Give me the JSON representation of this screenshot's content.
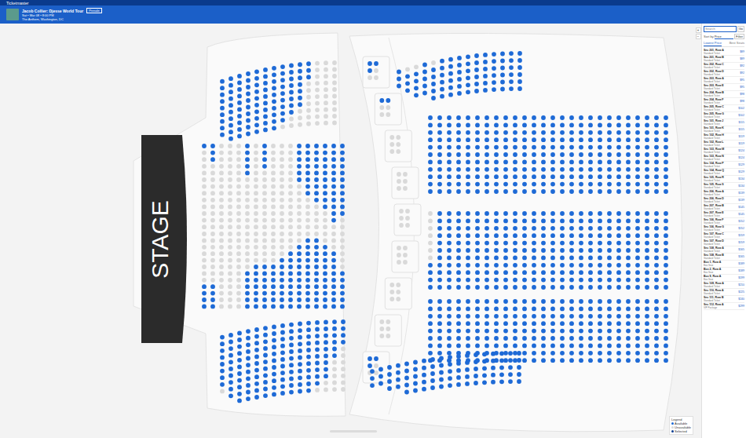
{
  "window": {
    "title": "Ticketmaster"
  },
  "header": {
    "title": "Jacob Collier: Djesse World Tour",
    "badge": "Presale",
    "date": "Sat • Mar 08 • 8:00 PM",
    "venue": "The Anthem, Washington, DC"
  },
  "stage": "STAGE",
  "zoom": [
    "+",
    "−"
  ],
  "panel": {
    "search_placeholder": "Search",
    "search_button": "Go",
    "sort_label": "Sort by",
    "sort_value": "Price",
    "filter_button": "Filter",
    "tabs": [
      {
        "label": "Lowest Price",
        "selected": true
      },
      {
        "label": "Best Seats",
        "selected": false
      }
    ],
    "listings": [
      {
        "section": "Sec 201, Row A",
        "detail": "Standard Ticket",
        "price": "$89"
      },
      {
        "section": "Sec 201, Row B",
        "detail": "Standard Ticket",
        "price": "$89"
      },
      {
        "section": "Sec 202, Row C",
        "detail": "Standard Ticket",
        "price": "$92"
      },
      {
        "section": "Sec 202, Row D",
        "detail": "Standard Ticket",
        "price": "$92"
      },
      {
        "section": "Sec 203, Row A",
        "detail": "Standard Ticket",
        "price": "$95"
      },
      {
        "section": "Sec 203, Row E",
        "detail": "Standard Ticket",
        "price": "$95"
      },
      {
        "section": "Sec 204, Row B",
        "detail": "Standard Ticket",
        "price": "$98"
      },
      {
        "section": "Sec 204, Row F",
        "detail": "Standard Ticket",
        "price": "$98"
      },
      {
        "section": "Sec 205, Row C",
        "detail": "Standard Ticket",
        "price": "$102"
      },
      {
        "section": "Sec 205, Row G",
        "detail": "Standard Ticket",
        "price": "$102"
      },
      {
        "section": "Sec 101, Row J",
        "detail": "Standard Ticket",
        "price": "$115"
      },
      {
        "section": "Sec 101, Row K",
        "detail": "Standard Ticket",
        "price": "$115"
      },
      {
        "section": "Sec 102, Row H",
        "detail": "Standard Ticket",
        "price": "$119"
      },
      {
        "section": "Sec 102, Row L",
        "detail": "Standard Ticket",
        "price": "$119"
      },
      {
        "section": "Sec 103, Row M",
        "detail": "Standard Ticket",
        "price": "$124"
      },
      {
        "section": "Sec 103, Row N",
        "detail": "Standard Ticket",
        "price": "$124"
      },
      {
        "section": "Sec 104, Row P",
        "detail": "Standard Ticket",
        "price": "$129"
      },
      {
        "section": "Sec 104, Row Q",
        "detail": "Standard Ticket",
        "price": "$129"
      },
      {
        "section": "Sec 105, Row R",
        "detail": "Standard Ticket",
        "price": "$134"
      },
      {
        "section": "Sec 105, Row S",
        "detail": "Standard Ticket",
        "price": "$134"
      },
      {
        "section": "Sec 206, Row A",
        "detail": "Standard Ticket",
        "price": "$139"
      },
      {
        "section": "Sec 206, Row D",
        "detail": "Standard Ticket",
        "price": "$139"
      },
      {
        "section": "Sec 207, Row B",
        "detail": "Standard Ticket",
        "price": "$145"
      },
      {
        "section": "Sec 207, Row E",
        "detail": "Standard Ticket",
        "price": "$145"
      },
      {
        "section": "Sec 106, Row F",
        "detail": "Standard Ticket",
        "price": "$152"
      },
      {
        "section": "Sec 106, Row G",
        "detail": "Standard Ticket",
        "price": "$152"
      },
      {
        "section": "Sec 107, Row C",
        "detail": "Standard Ticket",
        "price": "$159"
      },
      {
        "section": "Sec 107, Row D",
        "detail": "Standard Ticket",
        "price": "$159"
      },
      {
        "section": "Sec 108, Row A",
        "detail": "Standard Ticket",
        "price": "$165"
      },
      {
        "section": "Sec 108, Row B",
        "detail": "Standard Ticket",
        "price": "$165"
      },
      {
        "section": "Box 1, Row A",
        "detail": "Box Seat",
        "price": "$189"
      },
      {
        "section": "Box 2, Row A",
        "detail": "Box Seat",
        "price": "$189"
      },
      {
        "section": "Box 9, Row A",
        "detail": "Box Seat",
        "price": "$199"
      },
      {
        "section": "Sec 109, Row A",
        "detail": "Standard Ticket",
        "price": "$210"
      },
      {
        "section": "Sec 110, Row A",
        "detail": "Standard Ticket",
        "price": "$225"
      },
      {
        "section": "Sec 111, Row B",
        "detail": "Standard Ticket",
        "price": "$240"
      },
      {
        "section": "Sec 112, Row A",
        "detail": "VIP Package",
        "price": "$299"
      }
    ]
  },
  "legend": {
    "title": "Legend",
    "items": [
      {
        "label": "Available",
        "color": "#1e6ad6"
      },
      {
        "label": "Unavailable",
        "color": "#d9d9d9"
      },
      {
        "label": "Selected",
        "color": "#0b3d91"
      }
    ]
  },
  "sections": [
    {
      "open_from": "top",
      "columns": [
        {
          "seats": 9,
          "open": 9
        },
        {
          "seats": 10,
          "open": 10
        },
        {
          "seats": 10,
          "open": 10
        },
        {
          "seats": 10,
          "open": 10
        },
        {
          "seats": 10,
          "open": 10
        },
        {
          "seats": 10,
          "open": 10
        },
        {
          "seats": 10,
          "open": 10
        },
        {
          "seats": 10,
          "open": 9
        },
        {
          "seats": 10,
          "open": 8
        },
        {
          "seats": 10,
          "open": 7
        },
        {
          "seats": 10,
          "open": 3
        },
        {
          "seats": 10,
          "open": 0
        },
        {
          "seats": 10,
          "open": 0
        },
        {
          "seats": 10,
          "open": 0
        }
      ]
    },
    {
      "open_from": "top",
      "columns": [
        {
          "seats": 13,
          "open": 1
        },
        {
          "seats": 13,
          "open": 3
        },
        {
          "seats": 13,
          "open": 0
        },
        {
          "seats": 13,
          "open": 0
        },
        {
          "seats": 13,
          "open": 0
        },
        {
          "seats": 13,
          "open": 5
        },
        {
          "seats": 13,
          "open": 0
        },
        {
          "seats": 13,
          "open": 4
        },
        {
          "seats": 13,
          "open": 0
        },
        {
          "seats": 13,
          "open": 0
        },
        {
          "seats": 13,
          "open": 0
        },
        {
          "seats": 13,
          "open": 6
        },
        {
          "seats": 13,
          "open": 8
        },
        {
          "seats": 13,
          "open": 9
        },
        {
          "seats": 13,
          "open": 10
        },
        {
          "seats": 13,
          "open": 12
        },
        {
          "seats": 13,
          "open": 11
        }
      ]
    },
    {
      "open_from": "bottom",
      "columns": [
        {
          "seats": 12,
          "open": 4
        },
        {
          "seats": 12,
          "open": 4
        },
        {
          "seats": 12,
          "open": 0
        },
        {
          "seats": 12,
          "open": 0
        },
        {
          "seats": 12,
          "open": 0
        },
        {
          "seats": 12,
          "open": 6
        },
        {
          "seats": 12,
          "open": 7
        },
        {
          "seats": 12,
          "open": 7
        },
        {
          "seats": 12,
          "open": 7
        },
        {
          "seats": 12,
          "open": 8
        },
        {
          "seats": 12,
          "open": 9
        },
        {
          "seats": 12,
          "open": 10
        },
        {
          "seats": 12,
          "open": 11
        },
        {
          "seats": 12,
          "open": 11
        },
        {
          "seats": 12,
          "open": 10
        },
        {
          "seats": 12,
          "open": 9
        },
        {
          "seats": 12,
          "open": 6
        }
      ]
    },
    {
      "open_from": "top",
      "columns": [
        {
          "seats": 9,
          "open": 8
        },
        {
          "seats": 10,
          "open": 10
        },
        {
          "seats": 11,
          "open": 11
        },
        {
          "seats": 11,
          "open": 11
        },
        {
          "seats": 11,
          "open": 11
        },
        {
          "seats": 11,
          "open": 11
        },
        {
          "seats": 11,
          "open": 11
        },
        {
          "seats": 11,
          "open": 11
        },
        {
          "seats": 11,
          "open": 11
        },
        {
          "seats": 11,
          "open": 11
        },
        {
          "seats": 11,
          "open": 11
        },
        {
          "seats": 11,
          "open": 10
        },
        {
          "seats": 11,
          "open": 9
        },
        {
          "seats": 11,
          "open": 6
        },
        {
          "seats": 11,
          "open": 4
        }
      ]
    },
    {
      "open_from": "bottom",
      "columns": [
        {
          "seats": 3,
          "open": 3
        },
        {
          "seats": 4,
          "open": 3
        },
        {
          "seats": 5,
          "open": 4
        },
        {
          "seats": 5,
          "open": 5
        },
        {
          "seats": 6,
          "open": 5
        },
        {
          "seats": 6,
          "open": 6
        },
        {
          "seats": 6,
          "open": 6
        },
        {
          "seats": 6,
          "open": 6
        },
        {
          "seats": 6,
          "open": 6
        },
        {
          "seats": 6,
          "open": 6
        },
        {
          "seats": 6,
          "open": 6
        },
        {
          "seats": 6,
          "open": 6
        },
        {
          "seats": 6,
          "open": 6
        },
        {
          "seats": 6,
          "open": 6
        },
        {
          "seats": 6,
          "open": 6
        }
      ]
    },
    {
      "open_from": "top",
      "columns": [
        {
          "seats": 11,
          "open": 11
        },
        {
          "seats": 11,
          "open": 11
        },
        {
          "seats": 11,
          "open": 11
        },
        {
          "seats": 11,
          "open": 11
        },
        {
          "seats": 11,
          "open": 11
        },
        {
          "seats": 11,
          "open": 11
        },
        {
          "seats": 11,
          "open": 11
        },
        {
          "seats": 11,
          "open": 11
        },
        {
          "seats": 11,
          "open": 11
        },
        {
          "seats": 11,
          "open": 11
        },
        {
          "seats": 11,
          "open": 11
        },
        {
          "seats": 11,
          "open": 11
        },
        {
          "seats": 11,
          "open": 11
        },
        {
          "seats": 11,
          "open": 11
        },
        {
          "seats": 11,
          "open": 11
        },
        {
          "seats": 11,
          "open": 11
        },
        {
          "seats": 11,
          "open": 11
        },
        {
          "seats": 11,
          "open": 11
        },
        {
          "seats": 11,
          "open": 11
        },
        {
          "seats": 11,
          "open": 11
        },
        {
          "seats": 11,
          "open": 11
        },
        {
          "seats": 11,
          "open": 11
        },
        {
          "seats": 11,
          "open": 11
        },
        {
          "seats": 11,
          "open": 11
        },
        {
          "seats": 11,
          "open": 11
        },
        {
          "seats": 11,
          "open": 11
        }
      ]
    },
    {
      "open_from": "bottom",
      "columns": [
        {
          "seats": 11,
          "open": 4
        },
        {
          "seats": 11,
          "open": 11
        },
        {
          "seats": 11,
          "open": 11
        },
        {
          "seats": 11,
          "open": 11
        },
        {
          "seats": 11,
          "open": 11
        },
        {
          "seats": 11,
          "open": 11
        },
        {
          "seats": 11,
          "open": 11
        },
        {
          "seats": 11,
          "open": 11
        },
        {
          "seats": 11,
          "open": 11
        },
        {
          "seats": 11,
          "open": 11
        },
        {
          "seats": 11,
          "open": 11
        },
        {
          "seats": 11,
          "open": 11
        },
        {
          "seats": 11,
          "open": 11
        },
        {
          "seats": 11,
          "open": 11
        },
        {
          "seats": 11,
          "open": 11
        },
        {
          "seats": 11,
          "open": 11
        },
        {
          "seats": 11,
          "open": 11
        },
        {
          "seats": 11,
          "open": 11
        },
        {
          "seats": 11,
          "open": 11
        },
        {
          "seats": 11,
          "open": 11
        },
        {
          "seats": 11,
          "open": 11
        },
        {
          "seats": 11,
          "open": 11
        },
        {
          "seats": 11,
          "open": 11
        },
        {
          "seats": 11,
          "open": 11
        },
        {
          "seats": 11,
          "open": 11
        },
        {
          "seats": 11,
          "open": 11
        }
      ]
    },
    {
      "open_from": "top",
      "columns": [
        {
          "seats": 9,
          "open": 9
        },
        {
          "seats": 9,
          "open": 9
        },
        {
          "seats": 9,
          "open": 9
        },
        {
          "seats": 9,
          "open": 9
        },
        {
          "seats": 9,
          "open": 9
        },
        {
          "seats": 9,
          "open": 9
        },
        {
          "seats": 9,
          "open": 9
        },
        {
          "seats": 9,
          "open": 9
        },
        {
          "seats": 9,
          "open": 9
        },
        {
          "seats": 9,
          "open": 9
        },
        {
          "seats": 9,
          "open": 9
        },
        {
          "seats": 9,
          "open": 9
        },
        {
          "seats": 9,
          "open": 9
        },
        {
          "seats": 9,
          "open": 9
        },
        {
          "seats": 9,
          "open": 9
        },
        {
          "seats": 9,
          "open": 9
        },
        {
          "seats": 9,
          "open": 9
        },
        {
          "seats": 9,
          "open": 9
        },
        {
          "seats": 9,
          "open": 9
        },
        {
          "seats": 9,
          "open": 9
        },
        {
          "seats": 9,
          "open": 9
        },
        {
          "seats": 9,
          "open": 9
        },
        {
          "seats": 9,
          "open": 9
        },
        {
          "seats": 9,
          "open": 9
        },
        {
          "seats": 9,
          "open": 9
        },
        {
          "seats": 9,
          "open": 9
        }
      ]
    },
    {
      "open_from": "bottom",
      "columns": [
        {
          "seats": 3,
          "open": 3
        },
        {
          "seats": 3,
          "open": 3
        },
        {
          "seats": 4,
          "open": 4
        },
        {
          "seats": 4,
          "open": 4
        },
        {
          "seats": 5,
          "open": 5
        },
        {
          "seats": 5,
          "open": 5
        },
        {
          "seats": 5,
          "open": 5
        },
        {
          "seats": 5,
          "open": 5
        },
        {
          "seats": 5,
          "open": 5
        },
        {
          "seats": 5,
          "open": 5
        },
        {
          "seats": 5,
          "open": 5
        },
        {
          "seats": 5,
          "open": 5
        },
        {
          "seats": 5,
          "open": 5
        },
        {
          "seats": 5,
          "open": 5
        },
        {
          "seats": 5,
          "open": 5
        },
        {
          "seats": 5,
          "open": 5
        },
        {
          "seats": 5,
          "open": 5
        },
        {
          "seats": 5,
          "open": 5
        }
      ]
    }
  ],
  "boxes": [
    {
      "seats": 6,
      "open": 3
    },
    {
      "seats": 6,
      "open": 2
    },
    {
      "seats": 6,
      "open": 0
    },
    {
      "seats": 6,
      "open": 0
    },
    {
      "seats": 6,
      "open": 0
    },
    {
      "seats": 6,
      "open": 0
    },
    {
      "seats": 6,
      "open": 0
    },
    {
      "seats": 6,
      "open": 0
    },
    {
      "seats": 6,
      "open": 3
    }
  ]
}
